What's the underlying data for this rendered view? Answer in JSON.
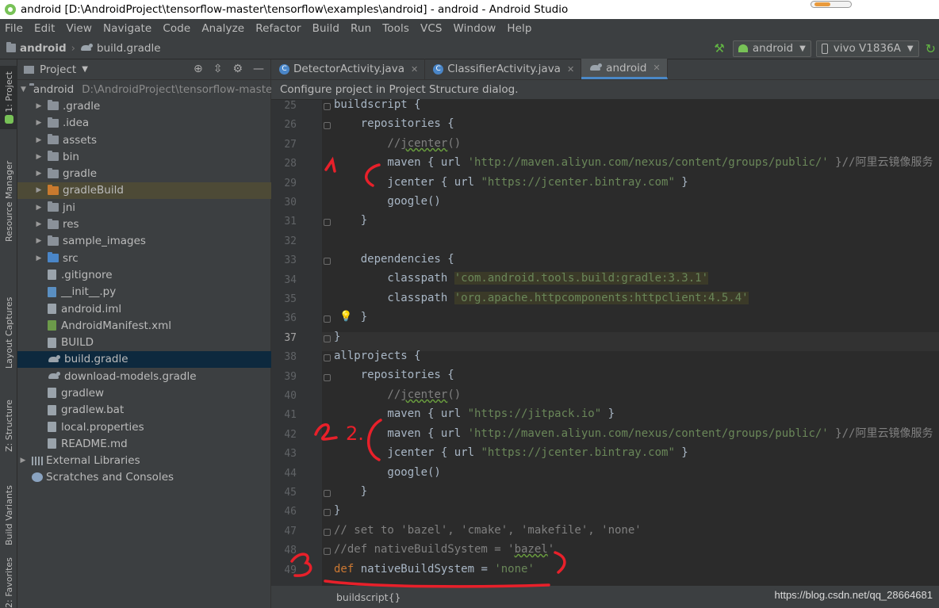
{
  "titlebar": {
    "title": "android [D:\\AndroidProject\\tensorflow-master\\tensorflow\\examples\\android] - android - Android Studio"
  },
  "menu": [
    "File",
    "Edit",
    "View",
    "Navigate",
    "Code",
    "Analyze",
    "Refactor",
    "Build",
    "Run",
    "Tools",
    "VCS",
    "Window",
    "Help"
  ],
  "navbar": {
    "crumb_project": "android",
    "crumb_file": "build.gradle",
    "run_config": "android",
    "device": "vivo V1836A"
  },
  "left_strip": [
    "1: Project",
    "Resource Manager",
    "Layout Captures",
    "Z: Structure",
    "Build Variants",
    "2: Favorites"
  ],
  "project_panel": {
    "title": "Project",
    "root_name": "android",
    "root_path": "D:\\AndroidProject\\tensorflow-master\\",
    "items": [
      {
        "label": ".gradle",
        "kind": "folder"
      },
      {
        "label": ".idea",
        "kind": "folder"
      },
      {
        "label": "assets",
        "kind": "folder"
      },
      {
        "label": "bin",
        "kind": "folder"
      },
      {
        "label": "gradle",
        "kind": "folder"
      },
      {
        "label": "gradleBuild",
        "kind": "folder-orange"
      },
      {
        "label": "jni",
        "kind": "folder"
      },
      {
        "label": "res",
        "kind": "folder"
      },
      {
        "label": "sample_images",
        "kind": "folder"
      },
      {
        "label": "src",
        "kind": "folder-blue"
      },
      {
        "label": ".gitignore",
        "kind": "file"
      },
      {
        "label": "__init__.py",
        "kind": "py"
      },
      {
        "label": "android.iml",
        "kind": "file"
      },
      {
        "label": "AndroidManifest.xml",
        "kind": "xml"
      },
      {
        "label": "BUILD",
        "kind": "file"
      },
      {
        "label": "build.gradle",
        "kind": "gradle"
      },
      {
        "label": "download-models.gradle",
        "kind": "gradle"
      },
      {
        "label": "gradlew",
        "kind": "file"
      },
      {
        "label": "gradlew.bat",
        "kind": "file"
      },
      {
        "label": "local.properties",
        "kind": "file"
      },
      {
        "label": "README.md",
        "kind": "file"
      }
    ],
    "external_libraries": "External Libraries",
    "scratches": "Scratches and Consoles"
  },
  "tabs": [
    {
      "label": "DetectorActivity.java"
    },
    {
      "label": "ClassifierActivity.java"
    },
    {
      "label": "android"
    }
  ],
  "banner": "Configure project in Project Structure dialog.",
  "lines": [
    "25",
    "26",
    "27",
    "28",
    "29",
    "30",
    "31",
    "32",
    "33",
    "34",
    "35",
    "36",
    "37",
    "38",
    "39",
    "40",
    "41",
    "42",
    "43",
    "44",
    "45",
    "46",
    "47",
    "48",
    "49"
  ],
  "code": {
    "l25": "buildscript {",
    "l26": "    repositories {",
    "l27a": "        //",
    "l27b": "jcenter",
    "l27c": "()",
    "l28a": "        maven { url ",
    "l28b": "'http://maven.aliyun.com/nexus/content/groups/public/'",
    "l28c": " }//阿里云镜像服务",
    "l29a": "        jcenter { url ",
    "l29b": "\"https://jcenter.bintray.com\"",
    "l29c": " }",
    "l30": "        google()",
    "l31": "    }",
    "l33": "    dependencies {",
    "l34a": "        classpath ",
    "l34b": "'com.android.tools.build:gradle:3.3.1'",
    "l35a": "        classpath ",
    "l35b": "'org.apache.httpcomponents:httpclient:4.5.4'",
    "l36": "    }",
    "l37": "}",
    "l38": "allprojects {",
    "l39": "    repositories {",
    "l40a": "        //",
    "l40b": "jcenter",
    "l40c": "()",
    "l41a": "        maven { url ",
    "l41b": "\"https://jitpack.io\"",
    "l41c": " }",
    "l42a": "        maven { url ",
    "l42b": "'http://maven.aliyun.com/nexus/content/groups/public/'",
    "l42c": " }//阿里云镜像服务",
    "l43a": "        jcenter { url ",
    "l43b": "\"https://jcenter.bintray.com\"",
    "l43c": " }",
    "l44": "        google()",
    "l45": "    }",
    "l46": "}",
    "l47": "// set to 'bazel', 'cmake', 'makefile', 'none'",
    "l48a": "//def nativeBuildSystem = '",
    "l48b": "bazel",
    "l48c": "'",
    "l49a": "def",
    "l49b": " nativeBuildSystem = ",
    "l49c": "'none'"
  },
  "annotations": {
    "n1": "1.",
    "n2": "2.",
    "n3": "3."
  },
  "statusbar": {
    "breadcrumb": "buildscript{}"
  },
  "watermark": "https://blog.csdn.net/qq_28664681",
  "colors": {
    "keyword": "#cc7832",
    "string": "#6a8759",
    "comment": "#808080",
    "annotation": "#e8202a"
  }
}
